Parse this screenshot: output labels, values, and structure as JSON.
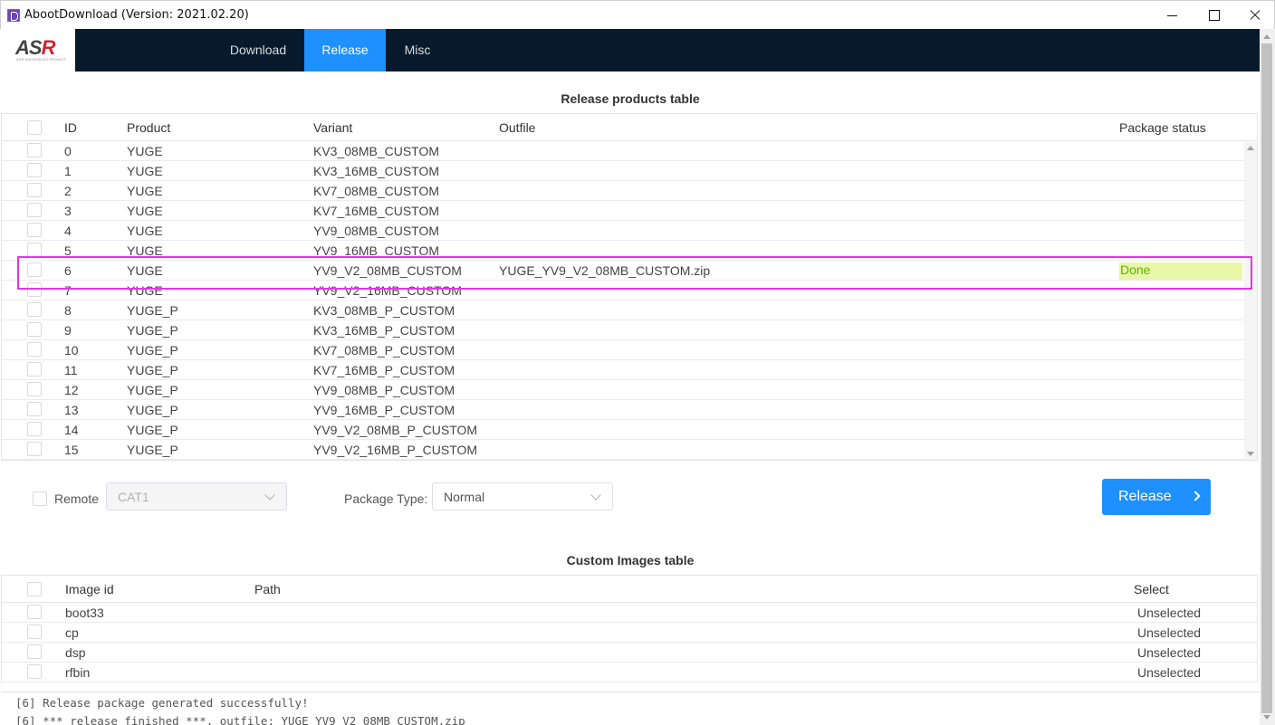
{
  "window": {
    "title": "AbootDownload (Version: 2021.02.20)"
  },
  "logo": {
    "main": "ASR",
    "sub": "ASR MICROELECTRONICS"
  },
  "nav": {
    "tabs": [
      {
        "label": "Download",
        "active": false
      },
      {
        "label": "Release",
        "active": true
      },
      {
        "label": "Misc",
        "active": false
      }
    ]
  },
  "release_table": {
    "title": "Release products table",
    "columns": {
      "id": "ID",
      "product": "Product",
      "variant": "Variant",
      "outfile": "Outfile",
      "status": "Package status"
    },
    "rows": [
      {
        "id": "0",
        "product": "YUGE",
        "variant": "KV3_08MB_CUSTOM",
        "outfile": "",
        "status": ""
      },
      {
        "id": "1",
        "product": "YUGE",
        "variant": "KV3_16MB_CUSTOM",
        "outfile": "",
        "status": ""
      },
      {
        "id": "2",
        "product": "YUGE",
        "variant": "KV7_08MB_CUSTOM",
        "outfile": "",
        "status": ""
      },
      {
        "id": "3",
        "product": "YUGE",
        "variant": "KV7_16MB_CUSTOM",
        "outfile": "",
        "status": ""
      },
      {
        "id": "4",
        "product": "YUGE",
        "variant": "YV9_08MB_CUSTOM",
        "outfile": "",
        "status": ""
      },
      {
        "id": "5",
        "product": "YUGE",
        "variant": "YV9_16MB_CUSTOM",
        "outfile": "",
        "status": ""
      },
      {
        "id": "6",
        "product": "YUGE",
        "variant": "YV9_V2_08MB_CUSTOM",
        "outfile": "YUGE_YV9_V2_08MB_CUSTOM.zip",
        "status": "Done"
      },
      {
        "id": "7",
        "product": "YUGE",
        "variant": "YV9_V2_16MB_CUSTOM",
        "outfile": "",
        "status": ""
      },
      {
        "id": "8",
        "product": "YUGE_P",
        "variant": "KV3_08MB_P_CUSTOM",
        "outfile": "",
        "status": ""
      },
      {
        "id": "9",
        "product": "YUGE_P",
        "variant": "KV3_16MB_P_CUSTOM",
        "outfile": "",
        "status": ""
      },
      {
        "id": "10",
        "product": "YUGE_P",
        "variant": "KV7_08MB_P_CUSTOM",
        "outfile": "",
        "status": ""
      },
      {
        "id": "11",
        "product": "YUGE_P",
        "variant": "KV7_16MB_P_CUSTOM",
        "outfile": "",
        "status": ""
      },
      {
        "id": "12",
        "product": "YUGE_P",
        "variant": "YV9_08MB_P_CUSTOM",
        "outfile": "",
        "status": ""
      },
      {
        "id": "13",
        "product": "YUGE_P",
        "variant": "YV9_16MB_P_CUSTOM",
        "outfile": "",
        "status": ""
      },
      {
        "id": "14",
        "product": "YUGE_P",
        "variant": "YV9_V2_08MB_P_CUSTOM",
        "outfile": "",
        "status": ""
      },
      {
        "id": "15",
        "product": "YUGE_P",
        "variant": "YV9_V2_16MB_P_CUSTOM",
        "outfile": "",
        "status": ""
      }
    ]
  },
  "controls": {
    "remote_label": "Remote",
    "remote_value": "CAT1",
    "package_type_label": "Package Type:",
    "package_type_value": "Normal",
    "release_button": "Release"
  },
  "images_table": {
    "title": "Custom Images table",
    "columns": {
      "image_id": "Image id",
      "path": "Path",
      "select": "Select"
    },
    "rows": [
      {
        "image_id": "boot33",
        "path": "",
        "select": "Unselected"
      },
      {
        "image_id": "cp",
        "path": "",
        "select": "Unselected"
      },
      {
        "image_id": "dsp",
        "path": "",
        "select": "Unselected"
      },
      {
        "image_id": "rfbin",
        "path": "",
        "select": "Unselected"
      }
    ]
  },
  "log": {
    "lines": [
      "[6] Release package generated successfully!",
      "[6] *** release finished ***, outfile: YUGE_YV9_V2_08MB_CUSTOM.zip"
    ]
  },
  "colors": {
    "nav_bg": "#061a2c",
    "accent": "#1e90ff",
    "done_text": "#5cb300",
    "done_bg": "#e8f7a8",
    "highlight": "#e535e5"
  }
}
